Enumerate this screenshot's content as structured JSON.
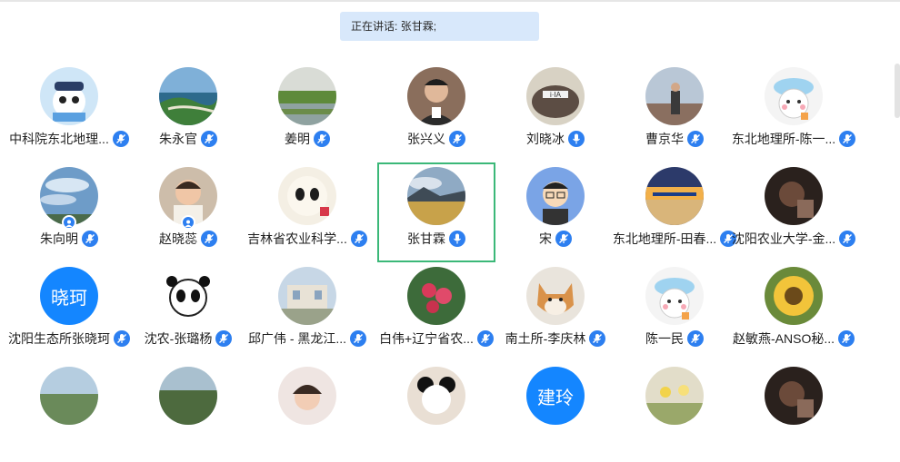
{
  "banner": {
    "label": "正在讲话:",
    "speakers": "张甘霖;"
  },
  "colors": {
    "accent": "#2d7ff0",
    "active_border": "#3bb878",
    "banner_bg": "#d8e8fb"
  },
  "participants": [
    {
      "name": "中科院东北地理...",
      "avatar": "panda-with-cap",
      "mic": "muted"
    },
    {
      "name": "朱永官",
      "avatar": "coastline-photo",
      "mic": "muted"
    },
    {
      "name": "姜明",
      "avatar": "wetland-photo",
      "mic": "muted"
    },
    {
      "name": "张兴义",
      "avatar": "man-portrait-photo",
      "mic": "muted"
    },
    {
      "name": "刘晓冰",
      "avatar": "logo-on-rock",
      "mic": "active"
    },
    {
      "name": "曹京华",
      "avatar": "man-standing-photo",
      "mic": "muted"
    },
    {
      "name": "东北地理所-陈一...",
      "avatar": "cartoon-bear-hat",
      "mic": "muted"
    },
    {
      "name": "朱向明",
      "avatar": "sky-photo",
      "mic": "muted",
      "role_badge": "participant-icon"
    },
    {
      "name": "赵晓蕊",
      "avatar": "child-photo",
      "mic": "muted",
      "role_badge": "participant-icon"
    },
    {
      "name": "吉林省农业科学...",
      "avatar": "panda-cartoon",
      "mic": "muted"
    },
    {
      "name": "张甘霖",
      "avatar": "field-landscape-photo",
      "mic": "active",
      "speaking": true
    },
    {
      "name": "宋",
      "avatar": "cartoon-man-glasses",
      "mic": "muted"
    },
    {
      "name": "东北地理所-田春...",
      "avatar": "sunset-beach-photo",
      "mic": "muted"
    },
    {
      "name": "沈阳农业大学-金...",
      "avatar": "dark-photo",
      "mic": "muted"
    },
    {
      "name": "沈阳生态所张晓珂",
      "avatar_text": "晓珂",
      "avatar": "text",
      "mic": "muted"
    },
    {
      "name": "沈农-张璐杨",
      "avatar": "panda-sketch",
      "mic": "muted"
    },
    {
      "name": "邱广伟 - 黑龙江...",
      "avatar": "building-photo",
      "mic": "muted"
    },
    {
      "name": "白伟+辽宁省农...",
      "avatar": "flower-photo",
      "mic": "muted"
    },
    {
      "name": "南土所-李庆林",
      "avatar": "shiba-dog-photo",
      "mic": "muted"
    },
    {
      "name": "陈一民",
      "avatar": "cartoon-bear-hat",
      "mic": "muted"
    },
    {
      "name": "赵敏燕-ANSO秘...",
      "avatar": "sunflower-photo",
      "mic": "muted"
    },
    {
      "name": "",
      "avatar": "outdoor-photo",
      "mic": "muted"
    },
    {
      "name": "",
      "avatar": "trees-photo",
      "mic": "muted"
    },
    {
      "name": "",
      "avatar": "woman-photo",
      "mic": "muted"
    },
    {
      "name": "",
      "avatar": "panda-hat-photo",
      "mic": "muted"
    },
    {
      "name": "",
      "avatar_text": "建玲",
      "avatar": "text",
      "mic": "muted"
    },
    {
      "name": "",
      "avatar": "flower-field-photo",
      "mic": "muted"
    },
    {
      "name": "",
      "avatar": "dark-photo",
      "mic": "muted"
    }
  ]
}
